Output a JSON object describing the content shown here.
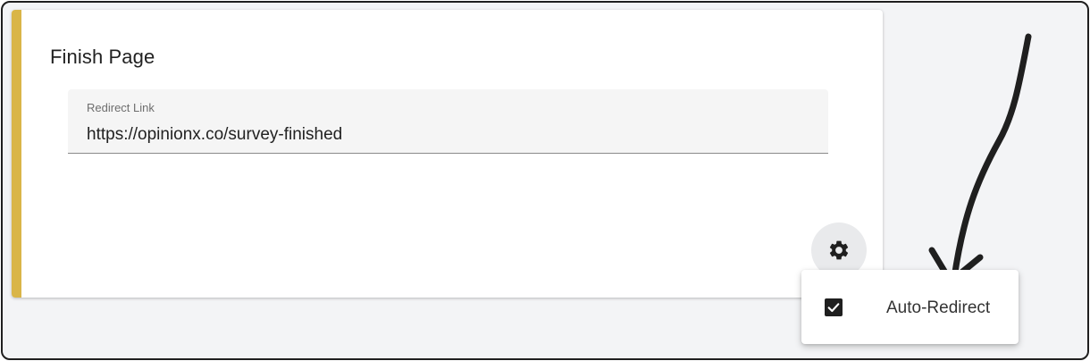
{
  "card": {
    "title": "Finish Page",
    "accent_color": "#d9b548"
  },
  "redirect_field": {
    "label": "Redirect Link",
    "value": "https://opinionx.co/survey-finished"
  },
  "settings_button": {
    "icon": "gear-icon"
  },
  "settings_menu": {
    "items": [
      {
        "label": "Auto-Redirect",
        "checked": true,
        "icon": "checkbox-checked-icon"
      }
    ]
  },
  "annotation": {
    "icon": "hand-drawn-arrow-icon",
    "color": "#1f1f1f"
  }
}
